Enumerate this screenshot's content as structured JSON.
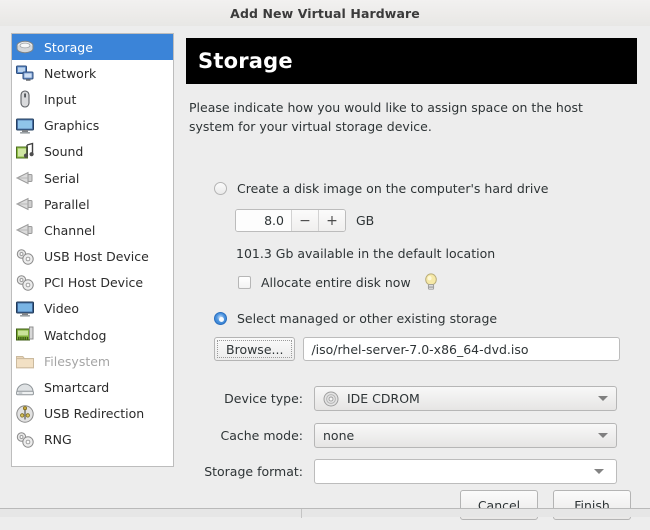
{
  "window": {
    "title": "Add New Virtual Hardware"
  },
  "sidebar": {
    "items": [
      {
        "label": "Storage",
        "icon": "hard-disk-icon",
        "selected": true,
        "disabled": false
      },
      {
        "label": "Network",
        "icon": "network-icon",
        "selected": false,
        "disabled": false
      },
      {
        "label": "Input",
        "icon": "mouse-icon",
        "selected": false,
        "disabled": false
      },
      {
        "label": "Graphics",
        "icon": "monitor-icon",
        "selected": false,
        "disabled": false
      },
      {
        "label": "Sound",
        "icon": "sound-icon",
        "selected": false,
        "disabled": false
      },
      {
        "label": "Serial",
        "icon": "serial-port-icon",
        "selected": false,
        "disabled": false
      },
      {
        "label": "Parallel",
        "icon": "parallel-port-icon",
        "selected": false,
        "disabled": false
      },
      {
        "label": "Channel",
        "icon": "channel-icon",
        "selected": false,
        "disabled": false
      },
      {
        "label": "USB Host Device",
        "icon": "usb-host-icon",
        "selected": false,
        "disabled": false
      },
      {
        "label": "PCI Host Device",
        "icon": "pci-host-icon",
        "selected": false,
        "disabled": false
      },
      {
        "label": "Video",
        "icon": "video-icon",
        "selected": false,
        "disabled": false
      },
      {
        "label": "Watchdog",
        "icon": "watchdog-card-icon",
        "selected": false,
        "disabled": false
      },
      {
        "label": "Filesystem",
        "icon": "folder-icon",
        "selected": false,
        "disabled": true
      },
      {
        "label": "Smartcard",
        "icon": "smartcard-icon",
        "selected": false,
        "disabled": false
      },
      {
        "label": "USB Redirection",
        "icon": "usb-redirection-icon",
        "selected": false,
        "disabled": false
      },
      {
        "label": "RNG",
        "icon": "rng-icon",
        "selected": false,
        "disabled": false
      }
    ]
  },
  "main": {
    "banner_title": "Storage",
    "description": "Please indicate how you would like to assign space on the host system for your virtual storage device.",
    "create_disk": {
      "label": "Create a disk image on the computer's hard drive",
      "selected": false,
      "size_value": "8.0",
      "decrement_label": "−",
      "increment_label": "+",
      "unit": "GB",
      "available_text": "101.3 Gb available in the default location",
      "allocate_label": "Allocate entire disk now",
      "allocate_checked": false,
      "tip_icon": "lightbulb-icon"
    },
    "managed_storage": {
      "label": "Select managed or other existing storage",
      "selected": true,
      "browse_label": "Browse...",
      "path_value": "/iso/rhel-server-7.0-x86_64-dvd.iso",
      "path_placeholder": ""
    },
    "fields": [
      {
        "label": "Device type:",
        "value": "IDE CDROM",
        "icon": "optical-disc-icon",
        "style": "button"
      },
      {
        "label": "Cache mode:",
        "value": "none",
        "icon": "",
        "style": "button"
      },
      {
        "label": "Storage format:",
        "value": "",
        "icon": "",
        "style": "entry"
      }
    ]
  },
  "buttons": {
    "cancel": "Cancel",
    "finish": "Finish"
  },
  "colors": {
    "selection_blue": "#3b84d8",
    "banner_bg": "#000000",
    "dialog_bg": "#ededed",
    "list_bg": "#ffffff",
    "disabled_text": "#a5a5a5"
  }
}
